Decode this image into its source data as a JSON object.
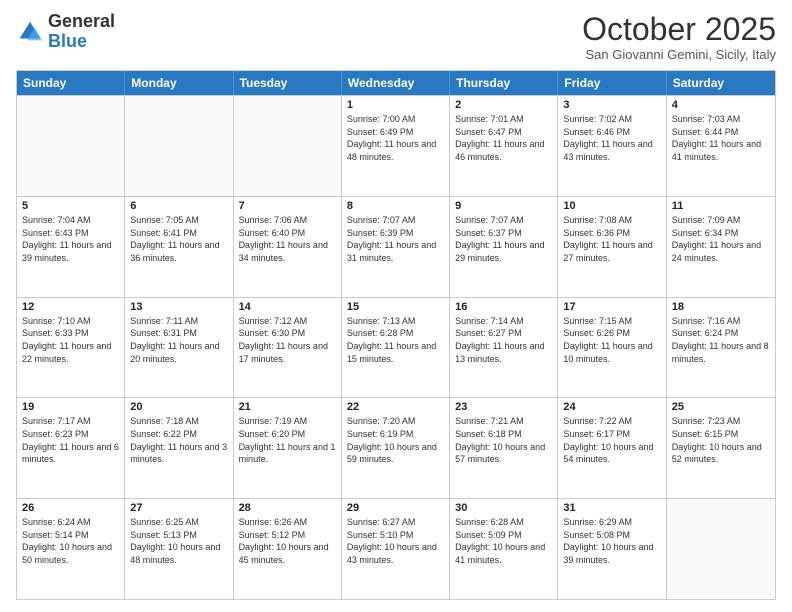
{
  "header": {
    "logo_general": "General",
    "logo_blue": "Blue",
    "month_title": "October 2025",
    "location": "San Giovanni Gemini, Sicily, Italy"
  },
  "days_of_week": [
    "Sunday",
    "Monday",
    "Tuesday",
    "Wednesday",
    "Thursday",
    "Friday",
    "Saturday"
  ],
  "weeks": [
    [
      {
        "day": "",
        "info": ""
      },
      {
        "day": "",
        "info": ""
      },
      {
        "day": "",
        "info": ""
      },
      {
        "day": "1",
        "info": "Sunrise: 7:00 AM\nSunset: 6:49 PM\nDaylight: 11 hours and 48 minutes."
      },
      {
        "day": "2",
        "info": "Sunrise: 7:01 AM\nSunset: 6:47 PM\nDaylight: 11 hours and 46 minutes."
      },
      {
        "day": "3",
        "info": "Sunrise: 7:02 AM\nSunset: 6:46 PM\nDaylight: 11 hours and 43 minutes."
      },
      {
        "day": "4",
        "info": "Sunrise: 7:03 AM\nSunset: 6:44 PM\nDaylight: 11 hours and 41 minutes."
      }
    ],
    [
      {
        "day": "5",
        "info": "Sunrise: 7:04 AM\nSunset: 6:43 PM\nDaylight: 11 hours and 39 minutes."
      },
      {
        "day": "6",
        "info": "Sunrise: 7:05 AM\nSunset: 6:41 PM\nDaylight: 11 hours and 36 minutes."
      },
      {
        "day": "7",
        "info": "Sunrise: 7:06 AM\nSunset: 6:40 PM\nDaylight: 11 hours and 34 minutes."
      },
      {
        "day": "8",
        "info": "Sunrise: 7:07 AM\nSunset: 6:39 PM\nDaylight: 11 hours and 31 minutes."
      },
      {
        "day": "9",
        "info": "Sunrise: 7:07 AM\nSunset: 6:37 PM\nDaylight: 11 hours and 29 minutes."
      },
      {
        "day": "10",
        "info": "Sunrise: 7:08 AM\nSunset: 6:36 PM\nDaylight: 11 hours and 27 minutes."
      },
      {
        "day": "11",
        "info": "Sunrise: 7:09 AM\nSunset: 6:34 PM\nDaylight: 11 hours and 24 minutes."
      }
    ],
    [
      {
        "day": "12",
        "info": "Sunrise: 7:10 AM\nSunset: 6:33 PM\nDaylight: 11 hours and 22 minutes."
      },
      {
        "day": "13",
        "info": "Sunrise: 7:11 AM\nSunset: 6:31 PM\nDaylight: 11 hours and 20 minutes."
      },
      {
        "day": "14",
        "info": "Sunrise: 7:12 AM\nSunset: 6:30 PM\nDaylight: 11 hours and 17 minutes."
      },
      {
        "day": "15",
        "info": "Sunrise: 7:13 AM\nSunset: 6:28 PM\nDaylight: 11 hours and 15 minutes."
      },
      {
        "day": "16",
        "info": "Sunrise: 7:14 AM\nSunset: 6:27 PM\nDaylight: 11 hours and 13 minutes."
      },
      {
        "day": "17",
        "info": "Sunrise: 7:15 AM\nSunset: 6:26 PM\nDaylight: 11 hours and 10 minutes."
      },
      {
        "day": "18",
        "info": "Sunrise: 7:16 AM\nSunset: 6:24 PM\nDaylight: 11 hours and 8 minutes."
      }
    ],
    [
      {
        "day": "19",
        "info": "Sunrise: 7:17 AM\nSunset: 6:23 PM\nDaylight: 11 hours and 6 minutes."
      },
      {
        "day": "20",
        "info": "Sunrise: 7:18 AM\nSunset: 6:22 PM\nDaylight: 11 hours and 3 minutes."
      },
      {
        "day": "21",
        "info": "Sunrise: 7:19 AM\nSunset: 6:20 PM\nDaylight: 11 hours and 1 minute."
      },
      {
        "day": "22",
        "info": "Sunrise: 7:20 AM\nSunset: 6:19 PM\nDaylight: 10 hours and 59 minutes."
      },
      {
        "day": "23",
        "info": "Sunrise: 7:21 AM\nSunset: 6:18 PM\nDaylight: 10 hours and 57 minutes."
      },
      {
        "day": "24",
        "info": "Sunrise: 7:22 AM\nSunset: 6:17 PM\nDaylight: 10 hours and 54 minutes."
      },
      {
        "day": "25",
        "info": "Sunrise: 7:23 AM\nSunset: 6:15 PM\nDaylight: 10 hours and 52 minutes."
      }
    ],
    [
      {
        "day": "26",
        "info": "Sunrise: 6:24 AM\nSunset: 5:14 PM\nDaylight: 10 hours and 50 minutes."
      },
      {
        "day": "27",
        "info": "Sunrise: 6:25 AM\nSunset: 5:13 PM\nDaylight: 10 hours and 48 minutes."
      },
      {
        "day": "28",
        "info": "Sunrise: 6:26 AM\nSunset: 5:12 PM\nDaylight: 10 hours and 45 minutes."
      },
      {
        "day": "29",
        "info": "Sunrise: 6:27 AM\nSunset: 5:10 PM\nDaylight: 10 hours and 43 minutes."
      },
      {
        "day": "30",
        "info": "Sunrise: 6:28 AM\nSunset: 5:09 PM\nDaylight: 10 hours and 41 minutes."
      },
      {
        "day": "31",
        "info": "Sunrise: 6:29 AM\nSunset: 5:08 PM\nDaylight: 10 hours and 39 minutes."
      },
      {
        "day": "",
        "info": ""
      }
    ]
  ]
}
